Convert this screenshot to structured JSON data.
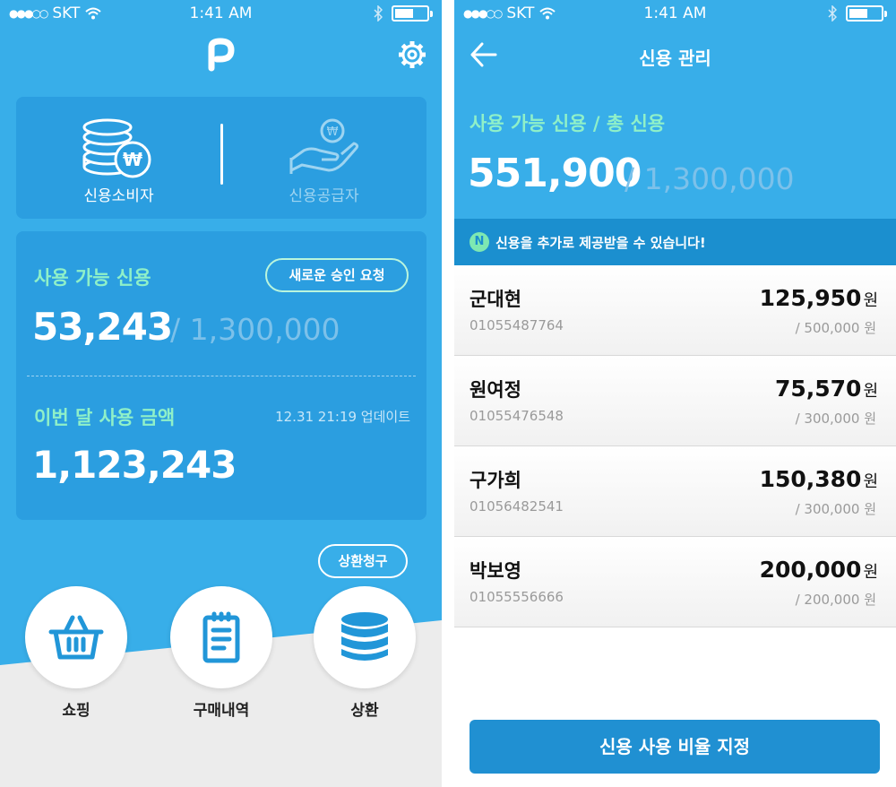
{
  "status_bar": {
    "carrier": "SKT",
    "time": "1:41 AM"
  },
  "left_screen": {
    "roles": {
      "consumer_label": "신용소비자",
      "supplier_label": "신용공급자"
    },
    "credit": {
      "available_label": "사용 가능 신용",
      "new_request_label": "새로운 승인 요청",
      "available_amount": "53,243",
      "total_amount": "/ 1,300,000",
      "month_label": "이번 달 사용 금액",
      "update_text": "12.31 21:19 업데이트",
      "month_amount": "1,123,243"
    },
    "repay_request_label": "상환청구",
    "nav": {
      "shopping": "쇼핑",
      "history": "구매내역",
      "repay": "상환"
    }
  },
  "right_screen": {
    "title": "신용 관리",
    "subtitle": "사용 가능 신용 / 총 신용",
    "available_amount": "551,900",
    "total_amount": "/ 1,300,000",
    "notice_badge": "N",
    "notice_text": "신용을 추가로 제공받을 수 있습니다!",
    "currency_unit": "원",
    "users": [
      {
        "name": "군대현",
        "phone": "01055487764",
        "amount": "125,950",
        "limit": "/  500,000 원"
      },
      {
        "name": "원여정",
        "phone": "01055476548",
        "amount": "75,570",
        "limit": "/  300,000 원"
      },
      {
        "name": "구가희",
        "phone": "01056482541",
        "amount": "150,380",
        "limit": "/  300,000 원"
      },
      {
        "name": "박보영",
        "phone": "01055556666",
        "amount": "200,000",
        "limit": "/  200,000 원"
      }
    ],
    "ratio_button_label": "신용 사용 비율 지정"
  },
  "colors": {
    "primary_blue": "#38aee9",
    "card_blue": "#2b9ee0",
    "mint_accent": "#8ff0c8",
    "dark_button_blue": "#2090d2"
  }
}
